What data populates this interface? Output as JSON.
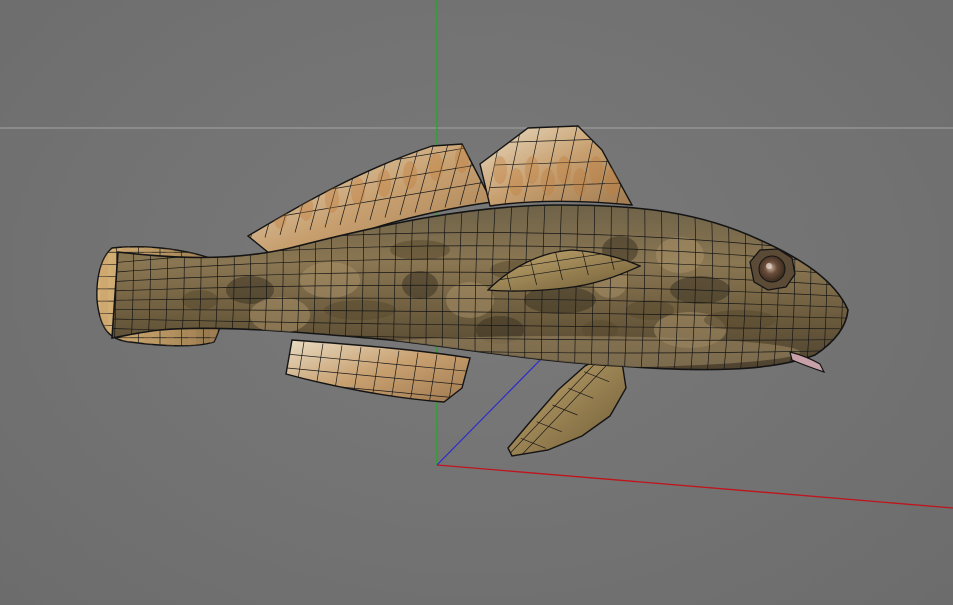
{
  "viewport": {
    "background_color": "#747474",
    "horizon_line_color": "#9a9a9a"
  },
  "axes": {
    "x_color": "#c0141c",
    "y_color": "#18b018",
    "z_color": "#2a2ad0"
  },
  "model": {
    "subject": "goby-fish-mesh",
    "display_mode": "textured-wireframe",
    "wire_color": "#141414",
    "body_tones": [
      "#7d6a48",
      "#5a4a30",
      "#a89068"
    ],
    "fin_tones": [
      "#d8c8a8",
      "#c09060",
      "#8a6a40"
    ],
    "eye_color": "#4a3a2a"
  }
}
